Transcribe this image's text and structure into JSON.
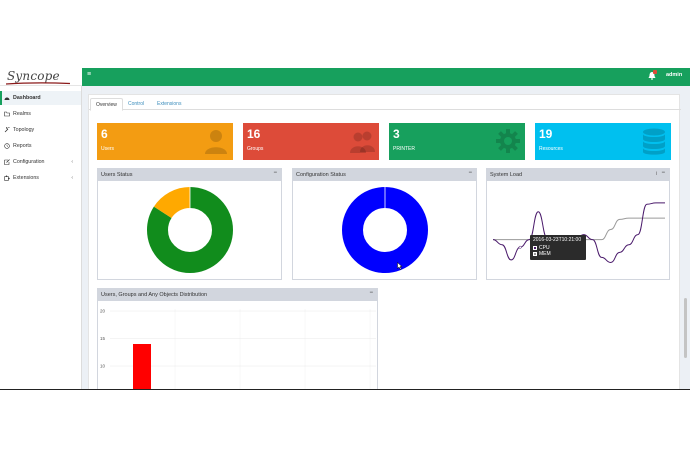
{
  "app": {
    "logo": "Syncope",
    "user": "admin"
  },
  "sidebar": {
    "items": [
      {
        "label": "Dashboard",
        "icon": "dashboard-icon"
      },
      {
        "label": "Realms",
        "icon": "folder-icon"
      },
      {
        "label": "Topology",
        "icon": "wrench-icon"
      },
      {
        "label": "Reports",
        "icon": "clock-icon"
      },
      {
        "label": "Configuration",
        "icon": "edit-icon"
      },
      {
        "label": "Extensions",
        "icon": "puzzle-icon"
      }
    ]
  },
  "tabs": [
    "Overview",
    "Control",
    "Extensions"
  ],
  "tiles": [
    {
      "value": "6",
      "label": "Users",
      "color": "#f39c12",
      "icon": "user-icon"
    },
    {
      "value": "16",
      "label": "Groups",
      "color": "#dd4b39",
      "icon": "group-icon"
    },
    {
      "value": "3",
      "label": "PRINTER",
      "color": "#17a05d",
      "icon": "gear-icon"
    },
    {
      "value": "19",
      "label": "Resources",
      "color": "#00c0ef",
      "icon": "database-icon"
    }
  ],
  "panels": {
    "users_status": "Users Status",
    "configuration_status": "Configuration Status",
    "system_load": "System Load",
    "distribution": "Users, Groups and Any Objects Distribution",
    "collapse": "−",
    "info": "i"
  },
  "tooltip": {
    "timestamp": "2016-03-23T10:21:00",
    "series": [
      "CPU",
      "MEM"
    ]
  },
  "chart_data": [
    {
      "type": "pie",
      "title": "Users Status",
      "slices": [
        {
          "value": 0.84,
          "color": "#118c1c"
        },
        {
          "value": 0.16,
          "color": "#ffa900"
        }
      ]
    },
    {
      "type": "pie",
      "title": "Configuration Status",
      "slices": [
        {
          "value": 1.0,
          "color": "#0000ff"
        }
      ]
    },
    {
      "type": "line",
      "title": "System Load",
      "series": [
        {
          "name": "CPU",
          "color": "#4a1a6b",
          "values": [
            2.0,
            1.6,
            0.4,
            1.4,
            2.0,
            4.2,
            2.1,
            0.8,
            1.0,
            1.8,
            2.4,
            2.0,
            0.6,
            0.2,
            1.0,
            1.6,
            2.4,
            4.8,
            4.9,
            4.9
          ]
        },
        {
          "name": "MEM",
          "color": "#9a9a9a",
          "values": [
            2.0,
            2.0,
            2.0,
            2.0,
            2.0,
            2.0,
            2.0,
            2.0,
            2.0,
            2.0,
            2.0,
            2.0,
            2.0,
            2.8,
            3.6,
            3.7,
            3.7,
            3.7,
            3.7,
            3.7
          ]
        }
      ],
      "ylim": [
        0,
        6
      ]
    },
    {
      "type": "bar",
      "title": "Users, Groups and Any Objects Distribution",
      "yticks": [
        "20",
        "15",
        "10"
      ],
      "ylim": [
        0,
        20
      ],
      "values": [
        14
      ],
      "color": "#ff0000"
    }
  ]
}
